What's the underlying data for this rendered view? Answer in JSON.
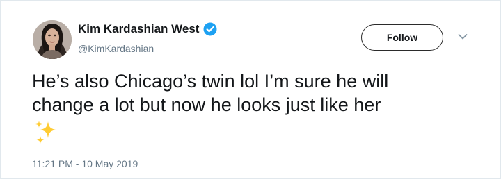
{
  "user": {
    "display_name": "Kim Kardashian West",
    "handle": "@KimKardashian",
    "verified": true,
    "avatar_icon": "profile-photo"
  },
  "actions": {
    "follow_label": "Follow",
    "more_icon": "chevron-down-icon"
  },
  "tweet": {
    "lines": [
      "He’s also Chicago’s twin lol I’m sure he will",
      "change a lot but now he looks just like her"
    ],
    "emoji": "sparkles-icon",
    "timestamp": "11:21 PM - 10 May 2019"
  },
  "colors": {
    "text_primary": "#14171a",
    "text_secondary": "#657786",
    "verified_blue": "#1da1f2",
    "sparkle_yellow": "#ffcc33",
    "border": "#e1e8ed"
  }
}
